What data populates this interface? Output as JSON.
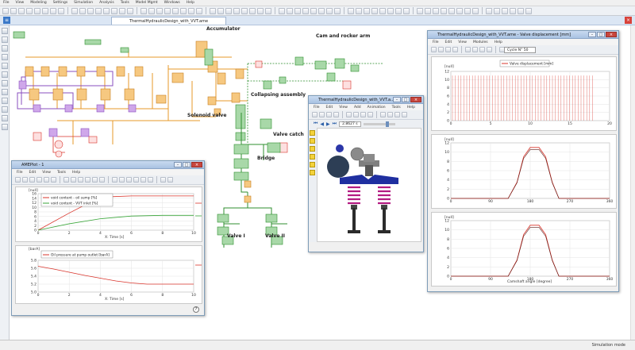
{
  "app": {
    "menus": [
      "File",
      "View",
      "Modeling",
      "Settings",
      "Simulation",
      "Analysis",
      "Tools",
      "Model Mgmt",
      "Windows",
      "Help"
    ],
    "document_tab": "ThermalHydraulicDesign_with_VVT.ame",
    "status": "Simulation mode"
  },
  "diagram": {
    "labels": {
      "accumulator": "Accumulator",
      "cam_rocker": "Cam and rocker arm",
      "collapsing": "Collapsing assembly",
      "solenoid": "Solenoid valve",
      "valve_catch": "Valve catch",
      "bridge": "Bridge",
      "valve1": "Valve I",
      "valve2": "Valve II"
    }
  },
  "amesplot": {
    "title": "AMEPlot - 1",
    "menus": [
      "File",
      "Edit",
      "View",
      "Tools",
      "Help"
    ],
    "plot1": {
      "unit": "[null]",
      "legend": [
        "void content - oil sump [%]",
        "void content - VVT inlet [%]"
      ],
      "xlabel": "X: Time [s]",
      "yticks": [
        "16",
        "14",
        "12",
        "10",
        "8",
        "6",
        "4",
        "2",
        "0"
      ],
      "xticks": [
        "0",
        "2",
        "4",
        "6",
        "8",
        "10"
      ]
    },
    "plot2": {
      "unit": "[barA]",
      "legend": [
        "Oil pressure at pump outlet [barA]"
      ],
      "xlabel": "X: Time [s]",
      "yticks": [
        "5.8",
        "5.6",
        "5.4",
        "5.2",
        "5.0"
      ],
      "xticks": [
        "0",
        "2",
        "4",
        "6",
        "8",
        "10"
      ]
    }
  },
  "anim": {
    "title": "ThermalHydraulicDesign_with_VVT.a...",
    "menus": [
      "File",
      "Edit",
      "View",
      "Add",
      "Animation",
      "Tools",
      "Help"
    ],
    "time": "2.8627 s"
  },
  "valvewin": {
    "title": "ThermalHydraulicDesign_with_VVT.ame - Valve displacement [mm]",
    "menus": [
      "File",
      "Edit",
      "View",
      "Modules",
      "Help"
    ],
    "cycle": "Cycle N° 50",
    "legend": "Valve displacement [mm]",
    "unit": "[null]",
    "p1": {
      "yticks": [
        "12",
        "10",
        "8",
        "6",
        "4",
        "2",
        "0"
      ],
      "xticks": [
        "0",
        "5",
        "10",
        "15",
        "20"
      ]
    },
    "p2": {
      "yticks": [
        "12",
        "10",
        "8",
        "6",
        "4",
        "2",
        "0"
      ],
      "xticks": [
        "0",
        "90",
        "180",
        "270",
        "360"
      ]
    },
    "p3": {
      "yticks": [
        "12",
        "10",
        "8",
        "6",
        "4",
        "2",
        "0"
      ],
      "xticks": [
        "0",
        "90",
        "180",
        "270",
        "360"
      ]
    },
    "xlabel3": "Camshaft angle [degree]"
  },
  "chart_data": [
    {
      "type": "line",
      "x": [
        0,
        2,
        4,
        6,
        8,
        10
      ],
      "series": [
        {
          "name": "void content - oil sump [%]",
          "color": "#d9342b",
          "y": [
            0,
            7.5,
            14.5,
            15,
            15,
            15
          ]
        },
        {
          "name": "void content - VVT inlet [%]",
          "color": "#3aa63a",
          "y": [
            0,
            2.8,
            5,
            6.2,
            6.5,
            6.5
          ]
        }
      ],
      "xlabel": "X: Time [s]",
      "ylabel": "[null]",
      "xlim": [
        0,
        10
      ],
      "ylim": [
        0,
        16
      ]
    },
    {
      "type": "line",
      "x": [
        0,
        1,
        2,
        3,
        4,
        5,
        6,
        7,
        8,
        9,
        10
      ],
      "series": [
        {
          "name": "Oil pressure at pump outlet [barA]",
          "color": "#d9342b",
          "y": [
            5.65,
            5.58,
            5.5,
            5.42,
            5.35,
            5.28,
            5.23,
            5.2,
            5.2,
            5.2,
            5.2
          ]
        }
      ],
      "xlabel": "X: Time [s]",
      "ylabel": "[barA]",
      "xlim": [
        0,
        10
      ],
      "ylim": [
        5.0,
        5.8
      ]
    },
    {
      "type": "line",
      "series": [
        {
          "name": "Valve displacement [mm]",
          "color": "#d9342b",
          "y": [
            0,
            11
          ]
        }
      ],
      "note_series": "repeated pulse every 0.36 from 0 to 18",
      "xlim": [
        0,
        20
      ],
      "ylim": [
        0,
        12
      ]
    },
    {
      "type": "line",
      "x": [
        0,
        130,
        150,
        165,
        180,
        200,
        215,
        230,
        245,
        360
      ],
      "series": [
        {
          "name": "Valve displacement [mm]",
          "color": "#d9342b",
          "y": [
            0,
            0,
            3.5,
            9,
            11,
            11,
            9,
            3.5,
            0,
            0
          ]
        }
      ],
      "xlim": [
        0,
        360
      ],
      "ylim": [
        0,
        12
      ]
    },
    {
      "type": "line",
      "x": [
        0,
        130,
        150,
        165,
        180,
        200,
        215,
        230,
        245,
        360
      ],
      "series": [
        {
          "name": "Valve displacement [mm]",
          "color": "#d9342b",
          "y": [
            0,
            0,
            3.5,
            9,
            11,
            11,
            9,
            3.5,
            0,
            0
          ]
        }
      ],
      "xlabel": "Camshaft angle [degree]",
      "xlim": [
        0,
        360
      ],
      "ylim": [
        0,
        12
      ]
    }
  ]
}
